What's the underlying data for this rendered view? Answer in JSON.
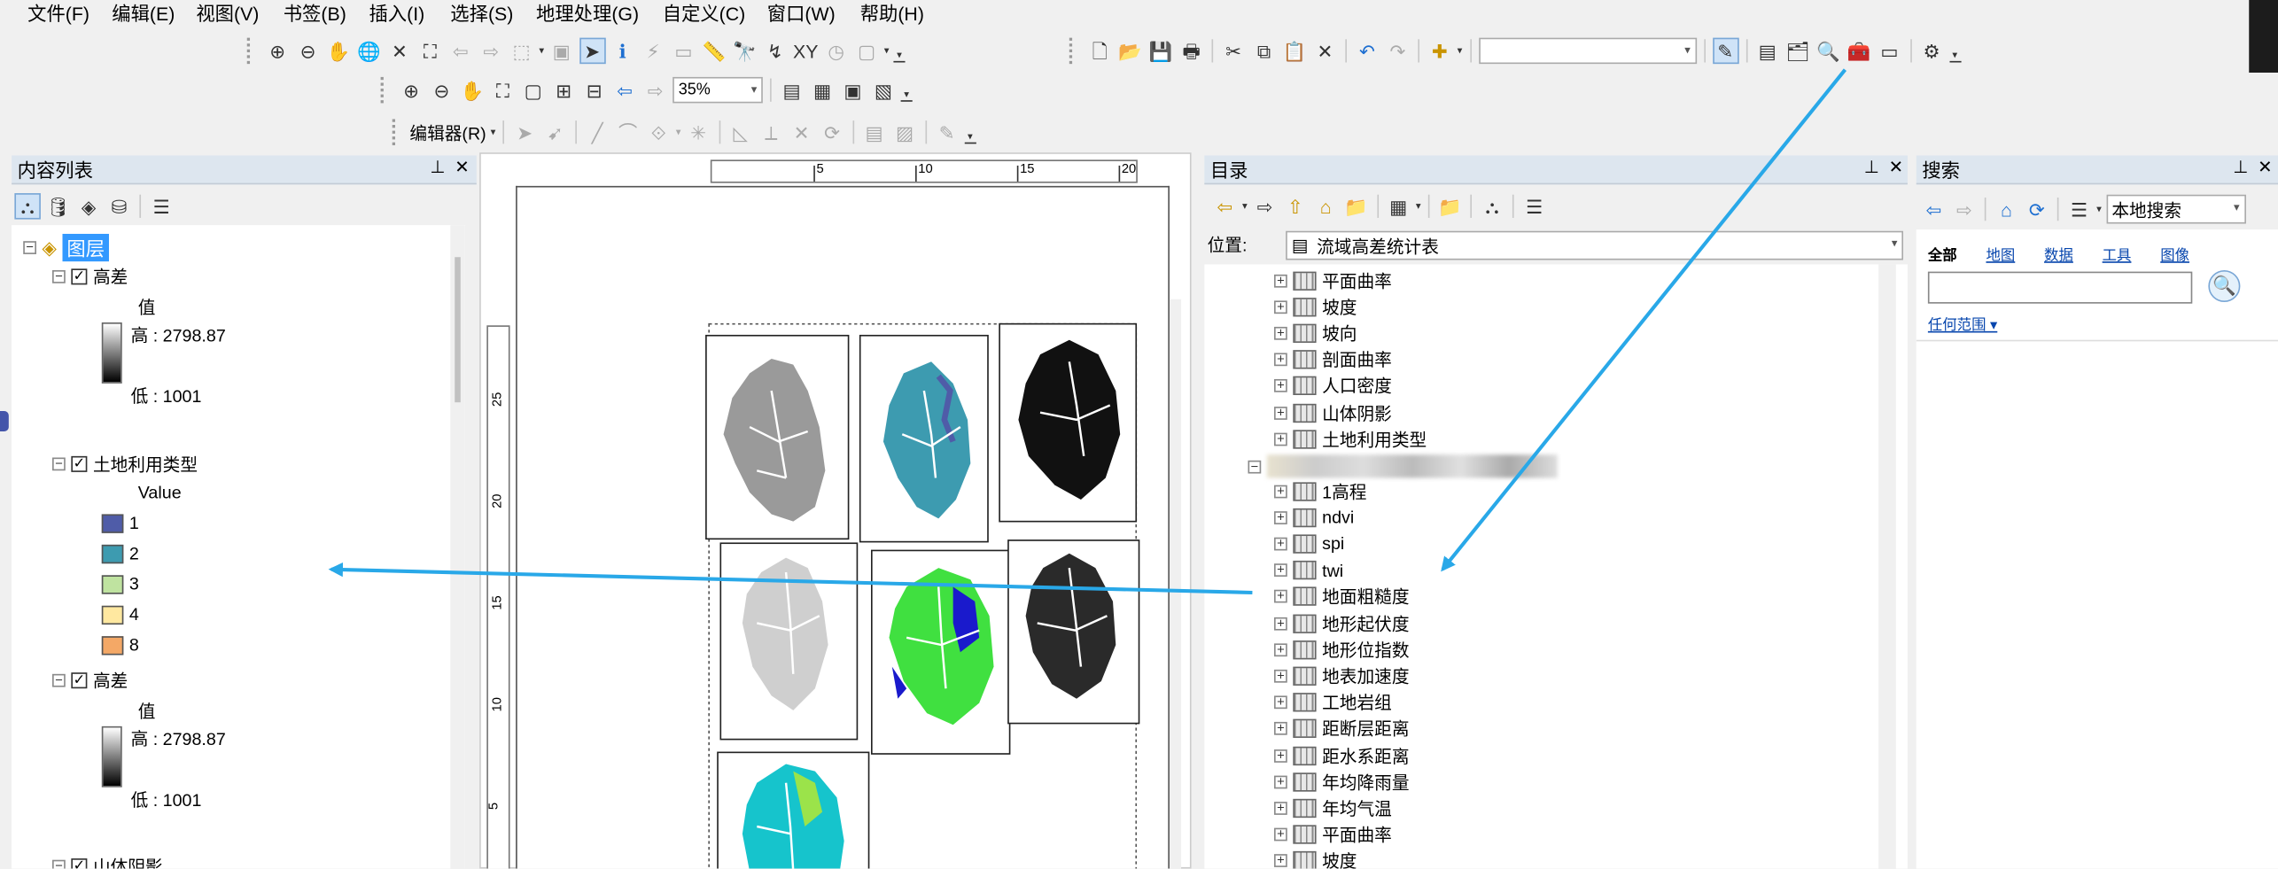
{
  "menu": [
    "文件(F)",
    "编辑(E)",
    "视图(V)",
    "书签(B)",
    "插入(I)",
    "选择(S)",
    "地理处理(G)",
    "自定义(C)",
    "窗口(W)",
    "帮助(H)"
  ],
  "toolbar": {
    "zoom_value": "35%",
    "editor_label": "编辑器(R)",
    "editor_dropdown": "▾"
  },
  "toc": {
    "title": "内容列表",
    "root_label": "图层",
    "layers": [
      {
        "name": "高差",
        "checked": true,
        "legend_heading": "值",
        "high": "高 : 2798.87",
        "low": "低 : 1001"
      },
      {
        "name": "土地利用类型",
        "checked": true,
        "legend_heading": "Value",
        "classes": [
          {
            "label": "1",
            "color": "#4f5ca8"
          },
          {
            "label": "2",
            "color": "#3d9bb0"
          },
          {
            "label": "3",
            "color": "#bfe3a0"
          },
          {
            "label": "4",
            "color": "#ffe8a0"
          },
          {
            "label": "8",
            "color": "#f4a866"
          }
        ]
      },
      {
        "name": "高差",
        "checked": true,
        "legend_heading": "值",
        "high": "高 : 2798.87",
        "low": "低 : 1001"
      },
      {
        "name": "山体阴影",
        "checked": true
      }
    ]
  },
  "ruler": {
    "h_ticks": [
      "5",
      "10",
      "15",
      "20"
    ],
    "v_ticks": [
      "25",
      "20",
      "15",
      "10",
      "5"
    ]
  },
  "catalog": {
    "title": "目录",
    "location_label": "位置:",
    "location_value": "流域高差统计表",
    "items_top": [
      "平面曲率",
      "坡度",
      "坡向",
      "剖面曲率",
      "人口密度",
      "山体阴影",
      "土地利用类型"
    ],
    "items_sub": [
      "1高程",
      "ndvi",
      "spi",
      "twi",
      "地面粗糙度",
      "地形起伏度",
      "地形位指数",
      "地表加速度",
      "工地岩组",
      "距断层距离",
      "距水系距离",
      "年均降雨量",
      "年均气温",
      "平面曲率",
      "坡度"
    ]
  },
  "search": {
    "title": "搜索",
    "scope": "本地搜索",
    "tabs": [
      "全部",
      "地图",
      "数据",
      "工具",
      "图像"
    ],
    "range_link": "任何范围 ▾",
    "input_value": ""
  },
  "panel_controls": {
    "pin": "⊥",
    "close": "✕"
  },
  "colors": {
    "accent": "#29a8e8",
    "panel_header": "#dde6ef",
    "selection": "#3399ff"
  }
}
